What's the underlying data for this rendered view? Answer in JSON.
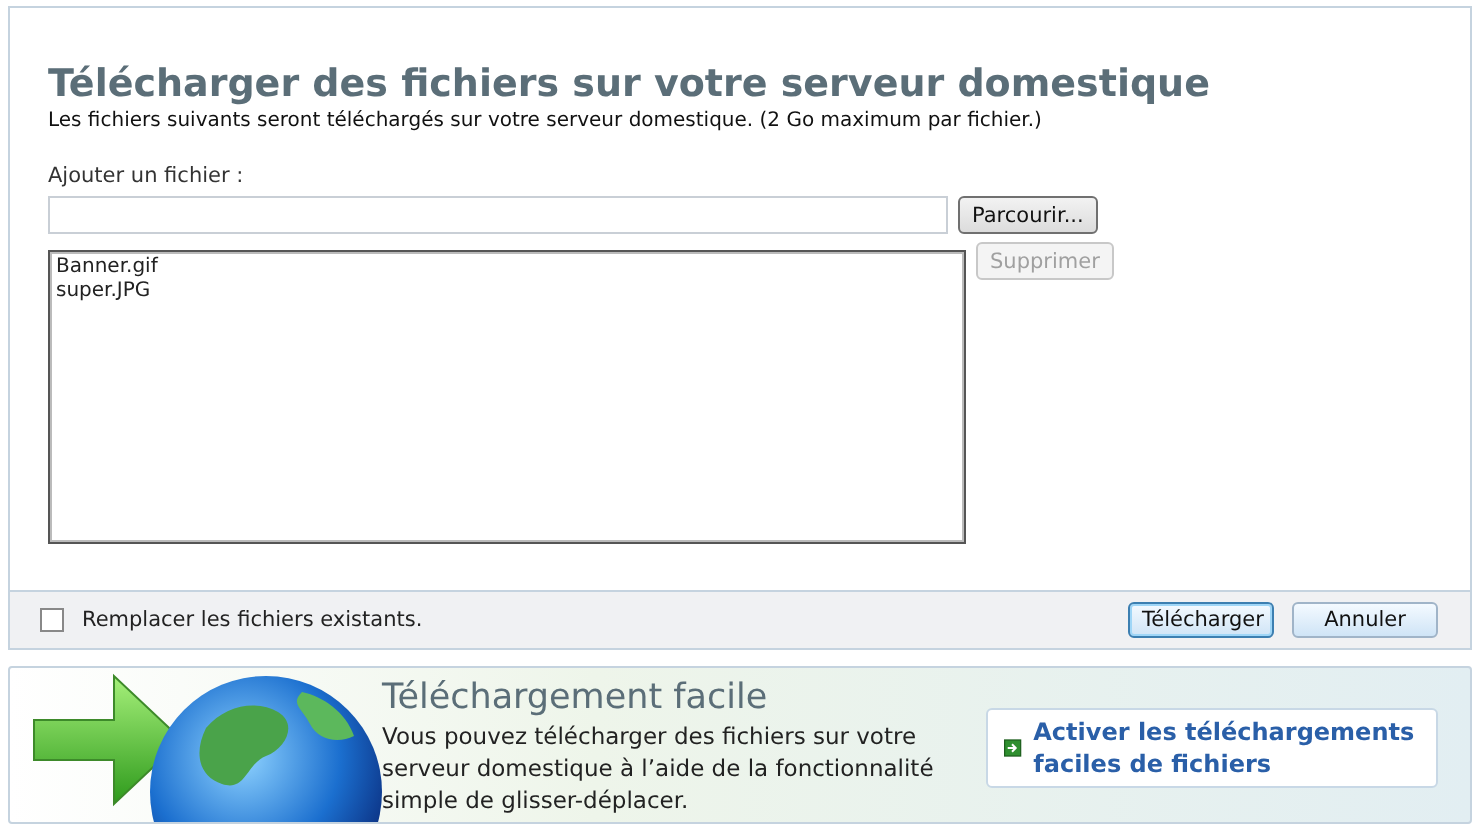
{
  "dialog": {
    "title": "Télécharger des fichiers sur votre serveur domestique",
    "subtitle": "Les fichiers suivants seront téléchargés sur votre serveur domestique. (2 Go maximum par fichier.)",
    "add_label": "Ajouter un fichier :",
    "browse_button": "Parcourir...",
    "files": [
      {
        "name": "Banner.gif",
        "selected": false
      },
      {
        "name": "super.JPG",
        "selected": false
      }
    ],
    "remove_button": {
      "label": "Supprimer",
      "disabled": true
    },
    "replace_checkbox": {
      "label": "Remplacer les fichiers existants.",
      "checked": false
    },
    "buttons": [
      {
        "label": "Télécharger",
        "default": true
      },
      {
        "label": "Annuler",
        "default": false
      }
    ]
  },
  "promo": {
    "title": "Téléchargement facile",
    "text": "Vous pouvez télécharger des fichiers sur votre serveur domestique à l’aide de la fonctionnalité simple de glisser-déplacer.",
    "action": "Activer les téléchargements faciles de fichiers"
  }
}
